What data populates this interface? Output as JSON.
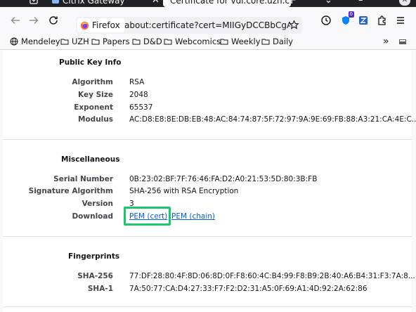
{
  "tabs": [
    {
      "label": "",
      "icon": "tab-list-icon"
    },
    {
      "label": "Citrix Gateway",
      "icon": "citrix-icon"
    },
    {
      "label": "Certificate for vdi.core.uzh.c",
      "icon": "",
      "active": true
    }
  ],
  "toolbar": {
    "identity_label": "Firefox",
    "url": "about:certificate?cert=MIIGyDCCBbCgAwIBAgIQ",
    "extension_badge": "0"
  },
  "bookmarks": [
    {
      "label": "Mendeley",
      "icon": "globe-icon"
    },
    {
      "label": "UZH",
      "icon": "folder-icon"
    },
    {
      "label": "Papers",
      "icon": "folder-icon"
    },
    {
      "label": "D&D",
      "icon": "folder-icon"
    },
    {
      "label": "Webcomics",
      "icon": "folder-icon"
    },
    {
      "label": "Weekly",
      "icon": "folder-icon"
    },
    {
      "label": "Daily",
      "icon": "folder-icon"
    }
  ],
  "sections": {
    "public_key": {
      "title": "Public Key Info",
      "rows": [
        {
          "label": "Algorithm",
          "value": "RSA"
        },
        {
          "label": "Key Size",
          "value": "2048"
        },
        {
          "label": "Exponent",
          "value": "65537"
        },
        {
          "label": "Modulus",
          "value": "AC:D8:E8:8E:DB:EB:48:AC:84:74:87:5F:72:97:9A:9E:69:FB:88:A3:21:CA:4E:C..."
        }
      ]
    },
    "misc": {
      "title": "Miscellaneous",
      "rows": [
        {
          "label": "Serial Number",
          "value": "0B:23:02:BF:7F:76:46:FA:D2:A0:21:53:5D:80:3B:FB"
        },
        {
          "label": "Signature Algorithm",
          "value": "SHA-256 with RSA Encryption"
        },
        {
          "label": "Version",
          "value": "3"
        }
      ],
      "download": {
        "label": "Download",
        "link_cert": "PEM (cert)",
        "link_chain": "PEM (chain)"
      }
    },
    "fingerprints": {
      "title": "Fingerprints",
      "rows": [
        {
          "label": "SHA-256",
          "value": "77:DF:28:80:4F:8D:06:8D:0F:F8:60:4C:B4:99:F8:B9:2B:40:A6:B4:31:F3:7A:8..."
        },
        {
          "label": "SHA-1",
          "value": "7A:50:77:CA:D4:27:33:F7:F2:D2:31:A5:0F:69:A1:4D:92:2A:62:86"
        }
      ]
    }
  },
  "colors": {
    "highlight": "#19c76f",
    "link": "#0060df",
    "tab_strip": "#202124"
  }
}
